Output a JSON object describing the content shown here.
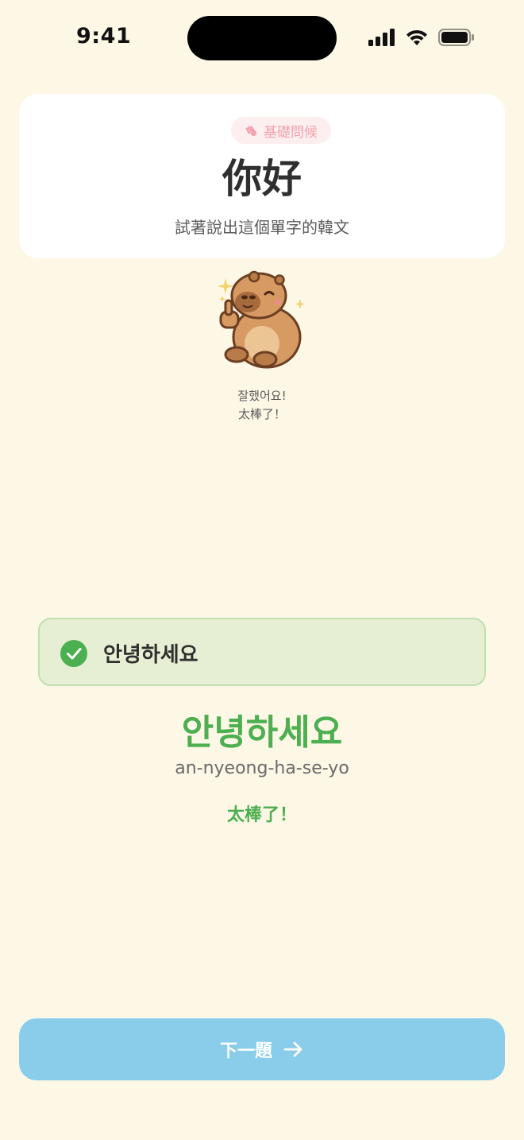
{
  "status_bar": {
    "time": "9:41"
  },
  "word_card": {
    "category": "基礎問候",
    "word": "你好",
    "instruction": "試著說出這個單字的韓文"
  },
  "mascot": {
    "speech_korean": "잘했어요!",
    "speech_chinese": "太棒了！"
  },
  "answer": {
    "spoken_text": "안녕하세요",
    "status": "correct"
  },
  "result": {
    "korean": "안녕하세요",
    "romanization": "an-nyeong-ha-se-yo",
    "feedback": "太棒了！"
  },
  "next_button": {
    "label": "下一題"
  },
  "colors": {
    "background": "#fdf7e6",
    "success": "#4caf50",
    "button": "#89cdea",
    "badge_bg": "#fdeef0"
  }
}
